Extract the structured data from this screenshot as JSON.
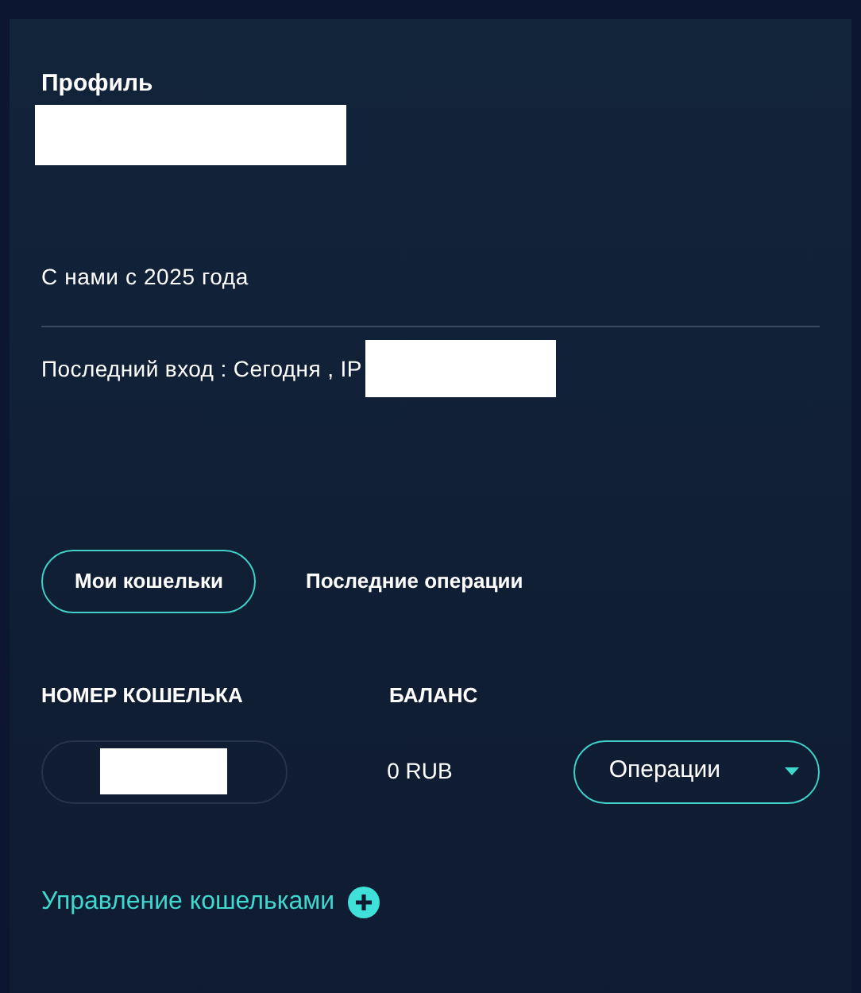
{
  "profile": {
    "title": "Профиль",
    "member_since": "С нами с 2025 года",
    "last_login": "Последний вход : Сегодня , IP"
  },
  "tabs": [
    {
      "label": "Мои кошельки",
      "selected": true
    },
    {
      "label": "Последние операции",
      "selected": false
    }
  ],
  "wallets": {
    "columns": [
      "НОМЕР КОШЕЛЬКА",
      "БАЛАНС"
    ],
    "rows": [
      {
        "balance": "0 RUB",
        "action": "Операции"
      }
    ]
  },
  "manage_link": "Управление кошельками"
}
